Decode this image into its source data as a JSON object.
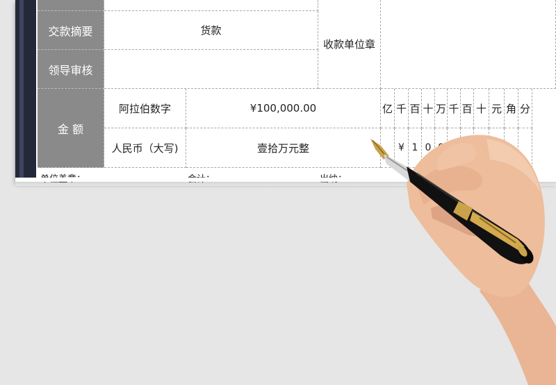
{
  "form": {
    "summary_label": "交款摘要",
    "summary_value": "货款",
    "stamp_label": "收款单位章",
    "review_label": "领导审核",
    "amount_label": "金 额",
    "arabic_label": "阿拉伯数字",
    "arabic_value": "¥100,000.00",
    "rmb_label": "人民币（大写)",
    "rmb_value": "壹拾万元整",
    "units": [
      "亿",
      "千",
      "百",
      "十",
      "万",
      "千",
      "百",
      "十",
      "元",
      "角",
      "分"
    ],
    "digits": [
      "",
      "¥",
      "1",
      "0",
      "0",
      "0",
      "",
      "",
      "",
      "",
      ""
    ],
    "footer": {
      "seal": "单位盖章：",
      "accountant": "会计：",
      "cashier": "出纳："
    }
  },
  "colors": {
    "label_bg": "#8a8a8a",
    "background": "#e6e6e6",
    "side_bar": "#24293a"
  }
}
